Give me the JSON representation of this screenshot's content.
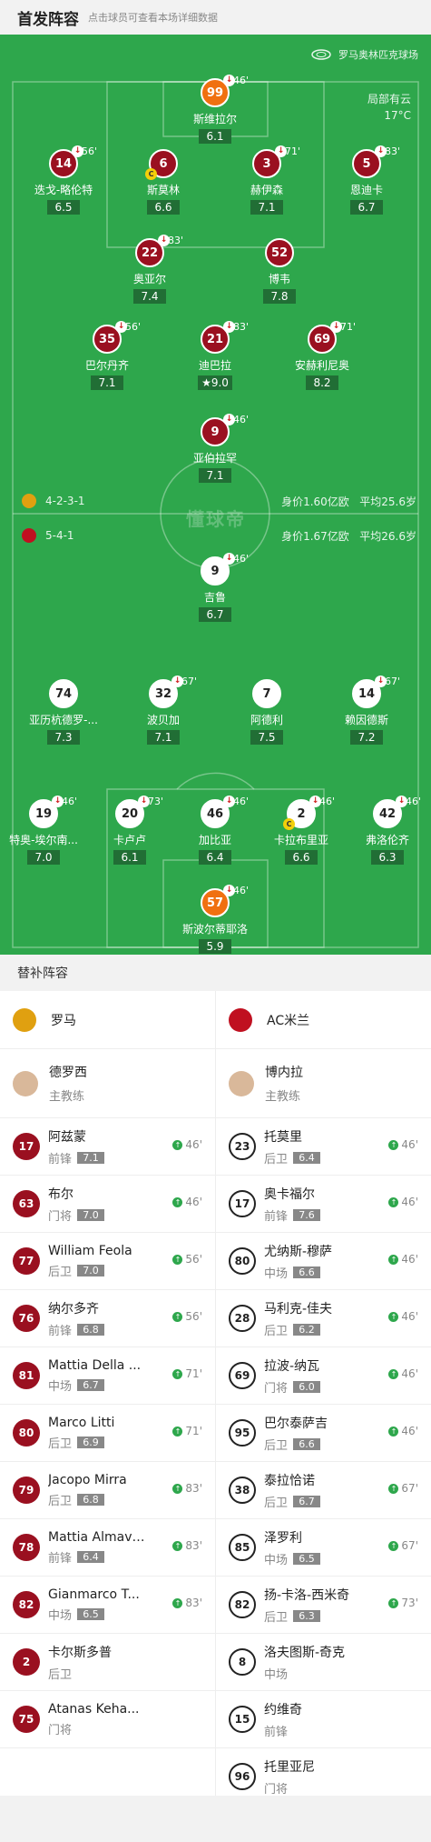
{
  "header": {
    "title": "首发阵容",
    "subtitle": "点击球员可查看本场详细数据"
  },
  "pitch": {
    "stadium": "罗马奥林匹克球场",
    "weather": "局部有云",
    "temperature": "17°C",
    "watermark": "懂球帝",
    "home_formation": "4-2-3-1",
    "home_value": "身价1.60亿欧",
    "home_age": "平均25.6岁",
    "away_formation": "5-4-1",
    "away_value": "身价1.67亿欧",
    "away_age": "平均26.6岁"
  },
  "home_players": [
    {
      "num": "99",
      "name": "斯维拉尔",
      "rating": "6.1",
      "sub": "46'",
      "gk": true
    },
    {
      "num": "14",
      "name": "迭戈-略伦特",
      "rating": "6.5",
      "sub": "56'"
    },
    {
      "num": "6",
      "name": "斯莫林",
      "rating": "6.6",
      "sub": "",
      "captain": true
    },
    {
      "num": "3",
      "name": "赫伊森",
      "rating": "7.1",
      "sub": "71'"
    },
    {
      "num": "5",
      "name": "恩迪卡",
      "rating": "6.7",
      "sub": "83'"
    },
    {
      "num": "22",
      "name": "奥亚尔",
      "rating": "7.4",
      "sub": "83'"
    },
    {
      "num": "52",
      "name": "博韦",
      "rating": "7.8",
      "sub": ""
    },
    {
      "num": "35",
      "name": "巴尔丹齐",
      "rating": "7.1",
      "sub": "56'"
    },
    {
      "num": "21",
      "name": "迪巴拉",
      "rating": "9.0",
      "sub": "83'",
      "star": true
    },
    {
      "num": "69",
      "name": "安赫利尼奥",
      "rating": "8.2",
      "sub": "71'"
    },
    {
      "num": "9",
      "name": "亚伯拉罕",
      "rating": "7.1",
      "sub": "46'"
    }
  ],
  "away_players": [
    {
      "num": "9",
      "name": "吉鲁",
      "rating": "6.7",
      "sub": "46'"
    },
    {
      "num": "74",
      "name": "亚历杭德罗-...",
      "rating": "7.3",
      "sub": ""
    },
    {
      "num": "32",
      "name": "波贝加",
      "rating": "7.1",
      "sub": "67'"
    },
    {
      "num": "7",
      "name": "阿德利",
      "rating": "7.5",
      "sub": ""
    },
    {
      "num": "14",
      "name": "赖因德斯",
      "rating": "7.2",
      "sub": "67'"
    },
    {
      "num": "19",
      "name": "特奥-埃尔南...",
      "rating": "7.0",
      "sub": "46'"
    },
    {
      "num": "20",
      "name": "卡卢卢",
      "rating": "6.1",
      "sub": "73'"
    },
    {
      "num": "46",
      "name": "加比亚",
      "rating": "6.4",
      "sub": "46'"
    },
    {
      "num": "2",
      "name": "卡拉布里亚",
      "rating": "6.6",
      "sub": "46'",
      "captain": true
    },
    {
      "num": "42",
      "name": "弗洛伦齐",
      "rating": "6.3",
      "sub": "46'"
    },
    {
      "num": "57",
      "name": "斯波尔蒂耶洛",
      "rating": "5.9",
      "sub": "46'",
      "gk": true
    }
  ],
  "subs_title": "替补阵容",
  "home_team": {
    "name": "罗马",
    "coach": "德罗西",
    "coach_role": "主教练"
  },
  "away_team": {
    "name": "AC米兰",
    "coach": "博内拉",
    "coach_role": "主教练"
  },
  "home_subs": [
    {
      "num": "17",
      "name": "阿兹蒙",
      "pos": "前锋",
      "rating": "7.1",
      "time": "46'"
    },
    {
      "num": "63",
      "name": "布尔",
      "pos": "门将",
      "rating": "7.0",
      "time": "46'"
    },
    {
      "num": "77",
      "name": "William Feola",
      "pos": "后卫",
      "rating": "7.0",
      "time": "56'"
    },
    {
      "num": "76",
      "name": "纳尔多齐",
      "pos": "前锋",
      "rating": "6.8",
      "time": "56'"
    },
    {
      "num": "81",
      "name": "Mattia Della ...",
      "pos": "中场",
      "rating": "6.7",
      "time": "71'"
    },
    {
      "num": "80",
      "name": "Marco Litti",
      "pos": "后卫",
      "rating": "6.9",
      "time": "71'"
    },
    {
      "num": "79",
      "name": "Jacopo Mirra",
      "pos": "后卫",
      "rating": "6.8",
      "time": "83'"
    },
    {
      "num": "78",
      "name": "Mattia Almaviva",
      "pos": "前锋",
      "rating": "6.4",
      "time": "83'"
    },
    {
      "num": "82",
      "name": "Gianmarco T...",
      "pos": "中场",
      "rating": "6.5",
      "time": "83'"
    },
    {
      "num": "2",
      "name": "卡尔斯多普",
      "pos": "后卫",
      "rating": "",
      "time": ""
    },
    {
      "num": "75",
      "name": "Atanas Keha...",
      "pos": "门将",
      "rating": "",
      "time": ""
    }
  ],
  "away_subs": [
    {
      "num": "23",
      "name": "托莫里",
      "pos": "后卫",
      "rating": "6.4",
      "time": "46'"
    },
    {
      "num": "17",
      "name": "奥卡福尔",
      "pos": "前锋",
      "rating": "7.6",
      "time": "46'"
    },
    {
      "num": "80",
      "name": "尤纳斯-穆萨",
      "pos": "中场",
      "rating": "6.6",
      "time": "46'"
    },
    {
      "num": "28",
      "name": "马利克-佳夫",
      "pos": "后卫",
      "rating": "6.2",
      "time": "46'"
    },
    {
      "num": "69",
      "name": "拉波-纳瓦",
      "pos": "门将",
      "rating": "6.0",
      "time": "46'"
    },
    {
      "num": "95",
      "name": "巴尔泰萨吉",
      "pos": "后卫",
      "rating": "6.6",
      "time": "46'"
    },
    {
      "num": "38",
      "name": "泰拉恰诺",
      "pos": "后卫",
      "rating": "6.7",
      "time": "67'"
    },
    {
      "num": "85",
      "name": "泽罗利",
      "pos": "中场",
      "rating": "6.5",
      "time": "67'"
    },
    {
      "num": "82",
      "name": "扬-卡洛-西米奇",
      "pos": "后卫",
      "rating": "6.3",
      "time": "73'"
    },
    {
      "num": "8",
      "name": "洛夫图斯-奇克",
      "pos": "中场",
      "rating": "",
      "time": ""
    },
    {
      "num": "15",
      "name": "约维奇",
      "pos": "前锋",
      "rating": "",
      "time": ""
    },
    {
      "num": "96",
      "name": "托里亚尼",
      "pos": "门将",
      "rating": "",
      "time": ""
    }
  ],
  "colors": {
    "pitch": "#2ea74c",
    "home": "#9a1020",
    "gk": "#f07010",
    "rating_bg": "#216e35"
  }
}
